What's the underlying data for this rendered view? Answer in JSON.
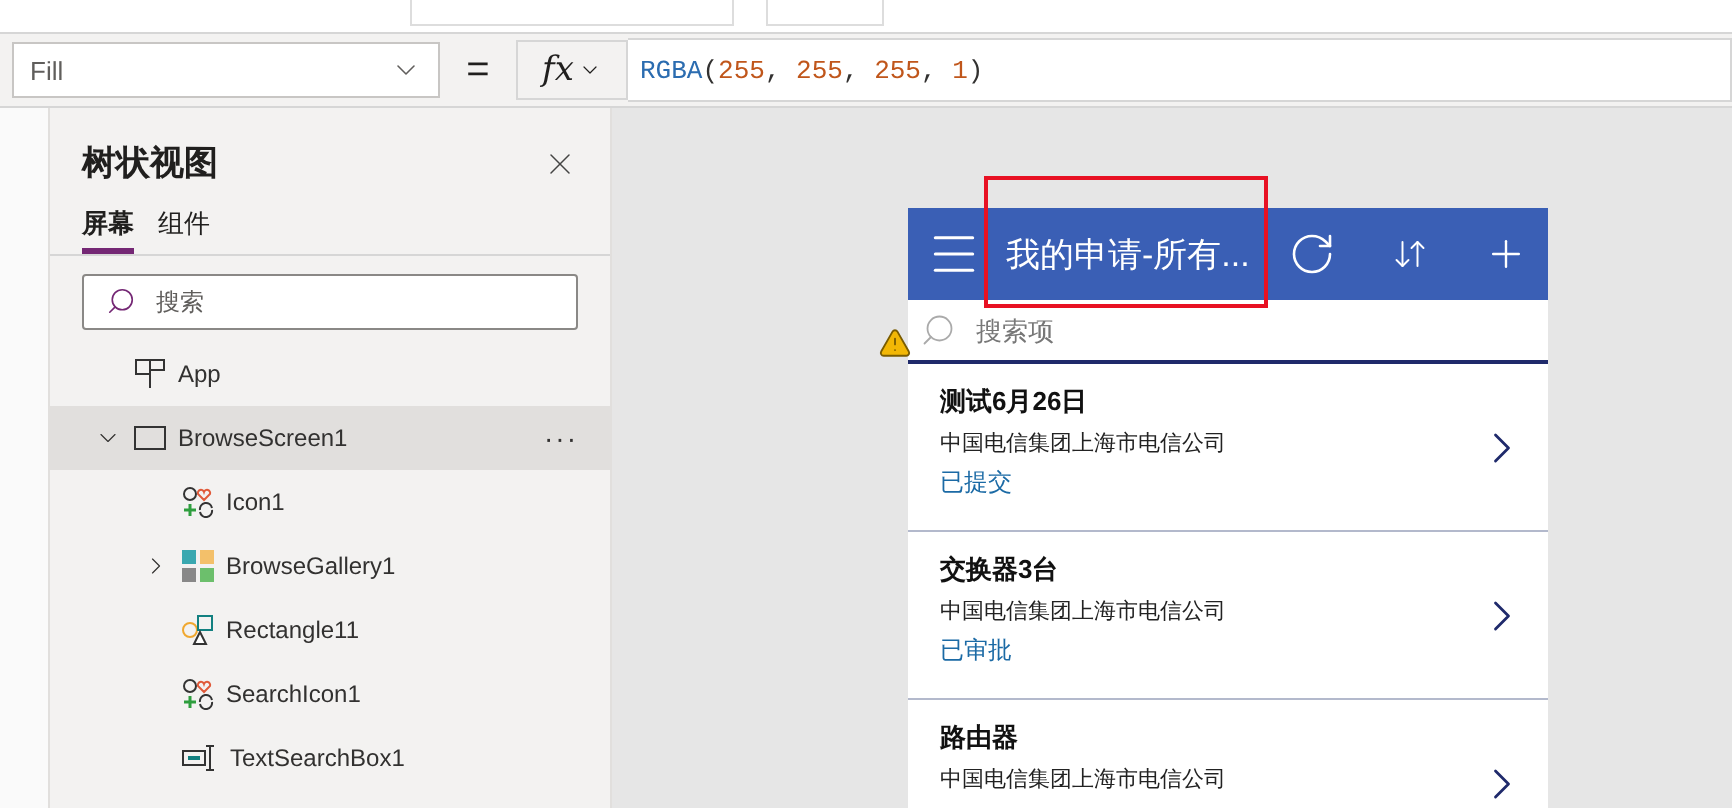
{
  "formula_bar": {
    "property": "Fill",
    "equals": "=",
    "fx_label": "fx",
    "tokens": [
      {
        "text": "RGBA",
        "kind": "function"
      },
      {
        "text": "(",
        "kind": "punct"
      },
      {
        "text": "255",
        "kind": "number"
      },
      {
        "text": ", ",
        "kind": "punct"
      },
      {
        "text": "255",
        "kind": "number"
      },
      {
        "text": ", ",
        "kind": "punct"
      },
      {
        "text": "255",
        "kind": "number"
      },
      {
        "text": ", ",
        "kind": "punct"
      },
      {
        "text": "1",
        "kind": "number"
      },
      {
        "text": ")",
        "kind": "punct"
      }
    ]
  },
  "tree_view": {
    "title": "树状视图",
    "tabs": [
      {
        "label": "屏幕",
        "selected": true
      },
      {
        "label": "组件",
        "selected": false
      }
    ],
    "search": {
      "placeholder": "搜索"
    },
    "more_label": "···",
    "items": [
      {
        "label": "App",
        "kind": "app",
        "selected": false
      },
      {
        "label": "BrowseScreen1",
        "kind": "screen",
        "selected": true,
        "expanded": true,
        "children": [
          {
            "label": "Icon1",
            "kind": "icon",
            "selected": false
          },
          {
            "label": "BrowseGallery1",
            "kind": "gallery",
            "selected": false,
            "expanded": false
          },
          {
            "label": "Rectangle11",
            "kind": "shape",
            "selected": false
          },
          {
            "label": "SearchIcon1",
            "kind": "icon",
            "selected": false
          },
          {
            "label": "TextSearchBox1",
            "kind": "textinput",
            "selected": false
          }
        ]
      }
    ]
  },
  "preview": {
    "title": "我的申请-所有...",
    "search": {
      "placeholder": "搜索项"
    },
    "items": [
      {
        "title": "测试6月26日",
        "subtitle": "中国电信集团上海市电信公司",
        "status": "已提交"
      },
      {
        "title": "交换器3台",
        "subtitle": "中国电信集团上海市电信公司",
        "status": "已审批"
      },
      {
        "title": "路由器",
        "subtitle": "中国电信集团上海市电信公司"
      }
    ]
  }
}
